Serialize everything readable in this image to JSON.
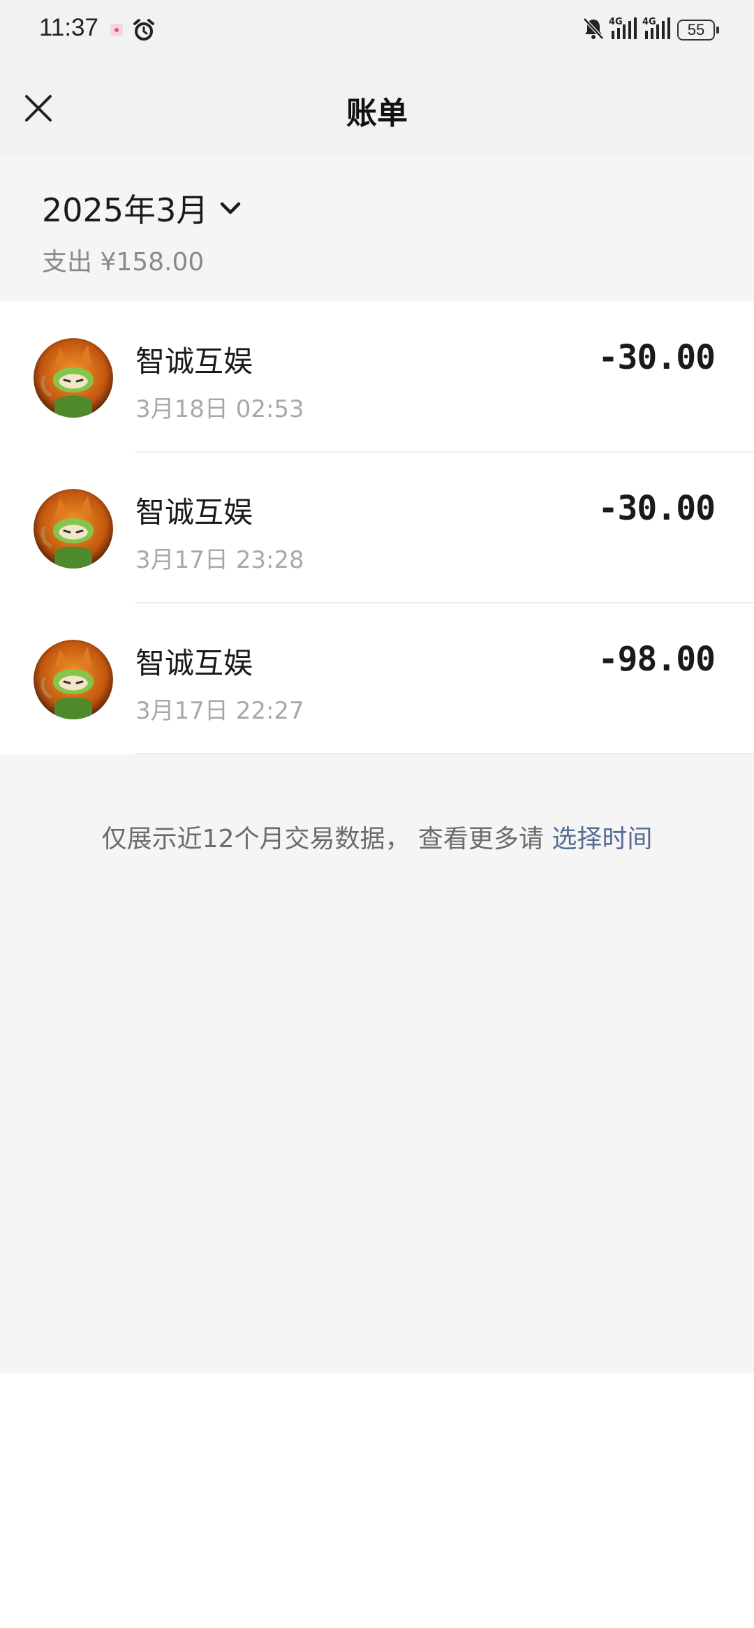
{
  "status_bar": {
    "time": "11:37",
    "battery": "55",
    "network_1": "4G",
    "network_2": "4G"
  },
  "header": {
    "title": "账单",
    "close_icon": "close-icon"
  },
  "summary": {
    "month": "2025年3月",
    "expense": "支出 ¥158.00"
  },
  "transactions": [
    {
      "merchant": "智诚互娱",
      "time": "3月18日 02:53",
      "amount": "-30.00"
    },
    {
      "merchant": "智诚互娱",
      "time": "3月17日 23:28",
      "amount": "-30.00"
    },
    {
      "merchant": "智诚互娱",
      "time": "3月17日 22:27",
      "amount": "-98.00"
    }
  ],
  "footer": {
    "note": "仅展示近12个月交易数据， 查看更多请 ",
    "link": "选择时间"
  },
  "colors": {
    "link": "#576b95",
    "background": "#f5f5f5",
    "header_background": "#f2f2f2"
  }
}
